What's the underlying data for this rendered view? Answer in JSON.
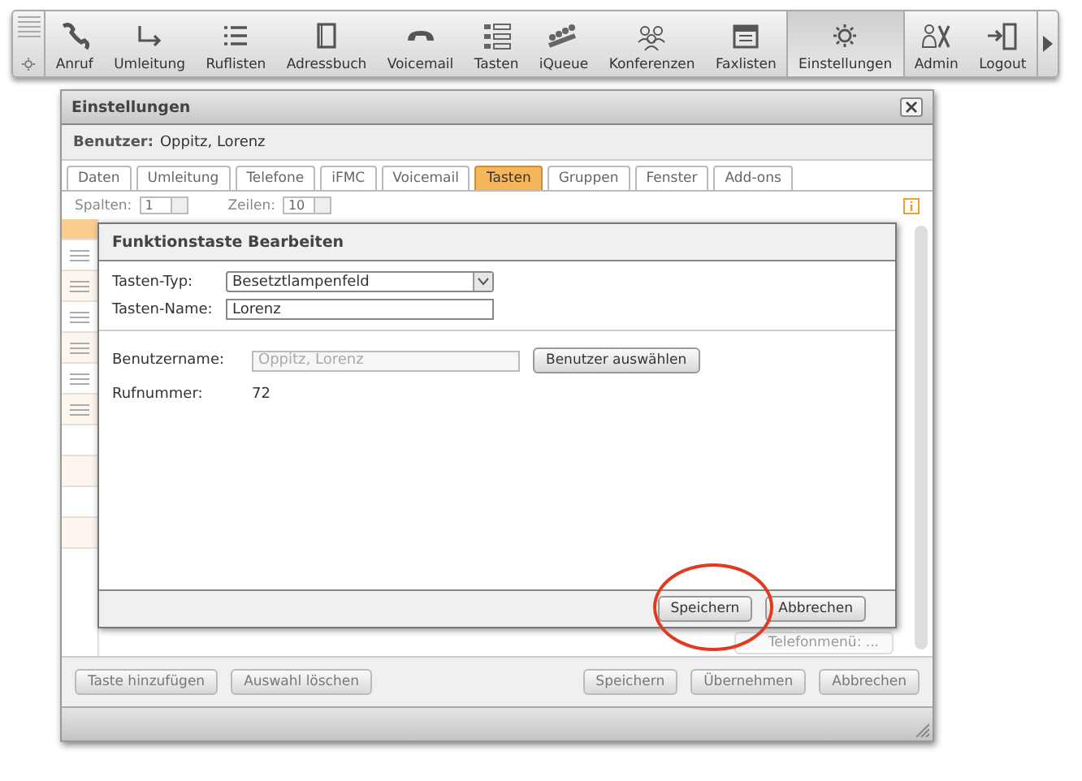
{
  "toolbar": {
    "items": [
      {
        "label": "Anruf",
        "selected": false
      },
      {
        "label": "Umleitung",
        "selected": false
      },
      {
        "label": "Ruflisten",
        "selected": false
      },
      {
        "label": "Adressbuch",
        "selected": false
      },
      {
        "label": "Voicemail",
        "selected": false
      },
      {
        "label": "Tasten",
        "selected": false
      },
      {
        "label": "iQueue",
        "selected": false
      },
      {
        "label": "Konferenzen",
        "selected": false
      },
      {
        "label": "Faxlisten",
        "selected": false
      },
      {
        "label": "Einstellungen",
        "selected": true
      },
      {
        "label": "Admin",
        "selected": false
      },
      {
        "label": "Logout",
        "selected": false
      }
    ]
  },
  "window": {
    "title": "Einstellungen",
    "user_label": "Benutzer:",
    "user_name": "Oppitz, Lorenz",
    "tabs": [
      {
        "label": "Daten",
        "selected": false
      },
      {
        "label": "Umleitung",
        "selected": false
      },
      {
        "label": "Telefone",
        "selected": false
      },
      {
        "label": "iFMC",
        "selected": false
      },
      {
        "label": "Voicemail",
        "selected": false
      },
      {
        "label": "Tasten",
        "selected": true
      },
      {
        "label": "Gruppen",
        "selected": false
      },
      {
        "label": "Fenster",
        "selected": false
      },
      {
        "label": "Add-ons",
        "selected": false
      }
    ],
    "columns_label": "Spalten:",
    "columns_value": "1",
    "rows_label": "Zeilen:",
    "rows_value": "10",
    "key_rows": [
      {
        "selected": true,
        "handle": false
      },
      {
        "selected": false,
        "handle": true
      },
      {
        "selected": false,
        "handle": true
      },
      {
        "selected": false,
        "handle": true
      },
      {
        "selected": false,
        "handle": true
      },
      {
        "selected": false,
        "handle": true
      },
      {
        "selected": false,
        "handle": true
      },
      {
        "selected": false,
        "handle": false
      },
      {
        "selected": false,
        "handle": false
      },
      {
        "selected": false,
        "handle": false
      },
      {
        "selected": false,
        "handle": false
      }
    ],
    "background_key": "Telefonmenü: ...",
    "left_buttons": [
      "Taste hinzufügen",
      "Auswahl löschen"
    ],
    "right_buttons": [
      "Speichern",
      "Übernehmen",
      "Abbrechen"
    ]
  },
  "dialog": {
    "title": "Funktionstaste Bearbeiten",
    "key_type_label": "Tasten-Typ:",
    "key_type_value": "Besetztlampenfeld",
    "key_name_label": "Tasten-Name:",
    "key_name_value": "Lorenz",
    "username_label": "Benutzername:",
    "username_placeholder": "Oppitz, Lorenz",
    "select_user_button": "Benutzer auswählen",
    "number_label": "Rufnummer:",
    "number_value": "72",
    "buttons": [
      {
        "label": "Speichern",
        "circled": true
      },
      {
        "label": "Abbrechen",
        "circled": false
      }
    ]
  }
}
